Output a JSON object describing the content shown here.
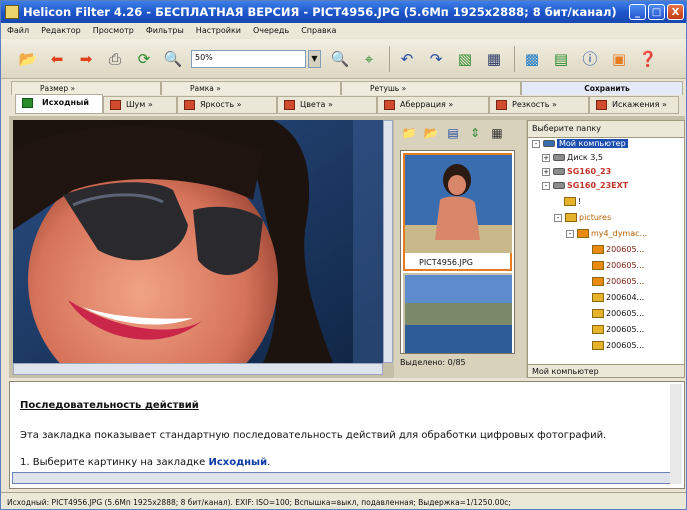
{
  "window": {
    "title": "Helicon Filter 4.26 - БЕСПЛАТНАЯ ВЕРСИЯ - PICT4956.JPG (5.6Мп 1925x2888; 8 бит/канал)",
    "controls": [
      "_",
      "□",
      "X"
    ]
  },
  "menu": [
    "Файл",
    "Редактор",
    "Просмотр",
    "Фильтры",
    "Настройки",
    "Очередь",
    "Справка"
  ],
  "toolbar": {
    "zoom_value": "50%",
    "icons": [
      "open-folder-icon",
      "back-arrow-icon",
      "forward-arrow-icon",
      "print-icon",
      "rotate-icon",
      "zoom-out-icon",
      "zoom-in-icon",
      "fit-icon",
      "undo-icon",
      "redo-icon",
      "batch-icon",
      "compare-icon",
      "thumbnails-icon",
      "tree-icon",
      "info-icon",
      "help-icon"
    ]
  },
  "tabs_row1": [
    {
      "label": "Размер »"
    },
    {
      "label": "Рамка »"
    },
    {
      "label": "Ретушь »"
    },
    {
      "label": "Сохранить"
    }
  ],
  "tabs_row2": [
    {
      "label": "Исходный"
    },
    {
      "label": "Шум »"
    },
    {
      "label": "Яркость »"
    },
    {
      "label": "Цвета »"
    },
    {
      "label": "Аберрация »"
    },
    {
      "label": "Резкость »"
    },
    {
      "label": "Искажения »"
    }
  ],
  "thumbnails": {
    "items": [
      {
        "filename": "PICT4956.JPG"
      }
    ],
    "selected": "Выделено: 0/85"
  },
  "folder_tree": {
    "header": "Выберите папку",
    "nodes": [
      "Мой компьютер",
      "Диск 3,5",
      "SG160_23",
      "SG160_23EXT",
      "!",
      "pictures",
      "my4_dymac...",
      "200605...",
      "200605...",
      "200605...",
      "200604...",
      "200605...",
      "200605...",
      "200605..."
    ],
    "status": "Мой компьютер"
  },
  "help": {
    "title": "Последовательность действий",
    "line1": "Эта закладка показывает стандартную последовательность действий для обработки цифровых фотографий.",
    "line2_prefix": "1. Выберите картинку на закладке ",
    "line2_link": "Исходный",
    "line2_suffix": "."
  },
  "statusbar": "Исходный: PICT4956.JPG (5.6Мп 1925x2888; 8 бит/канал). EXIF: ISO=100; Вспышка=выкл, подавленная; Выдержка=1/1250.00с;"
}
